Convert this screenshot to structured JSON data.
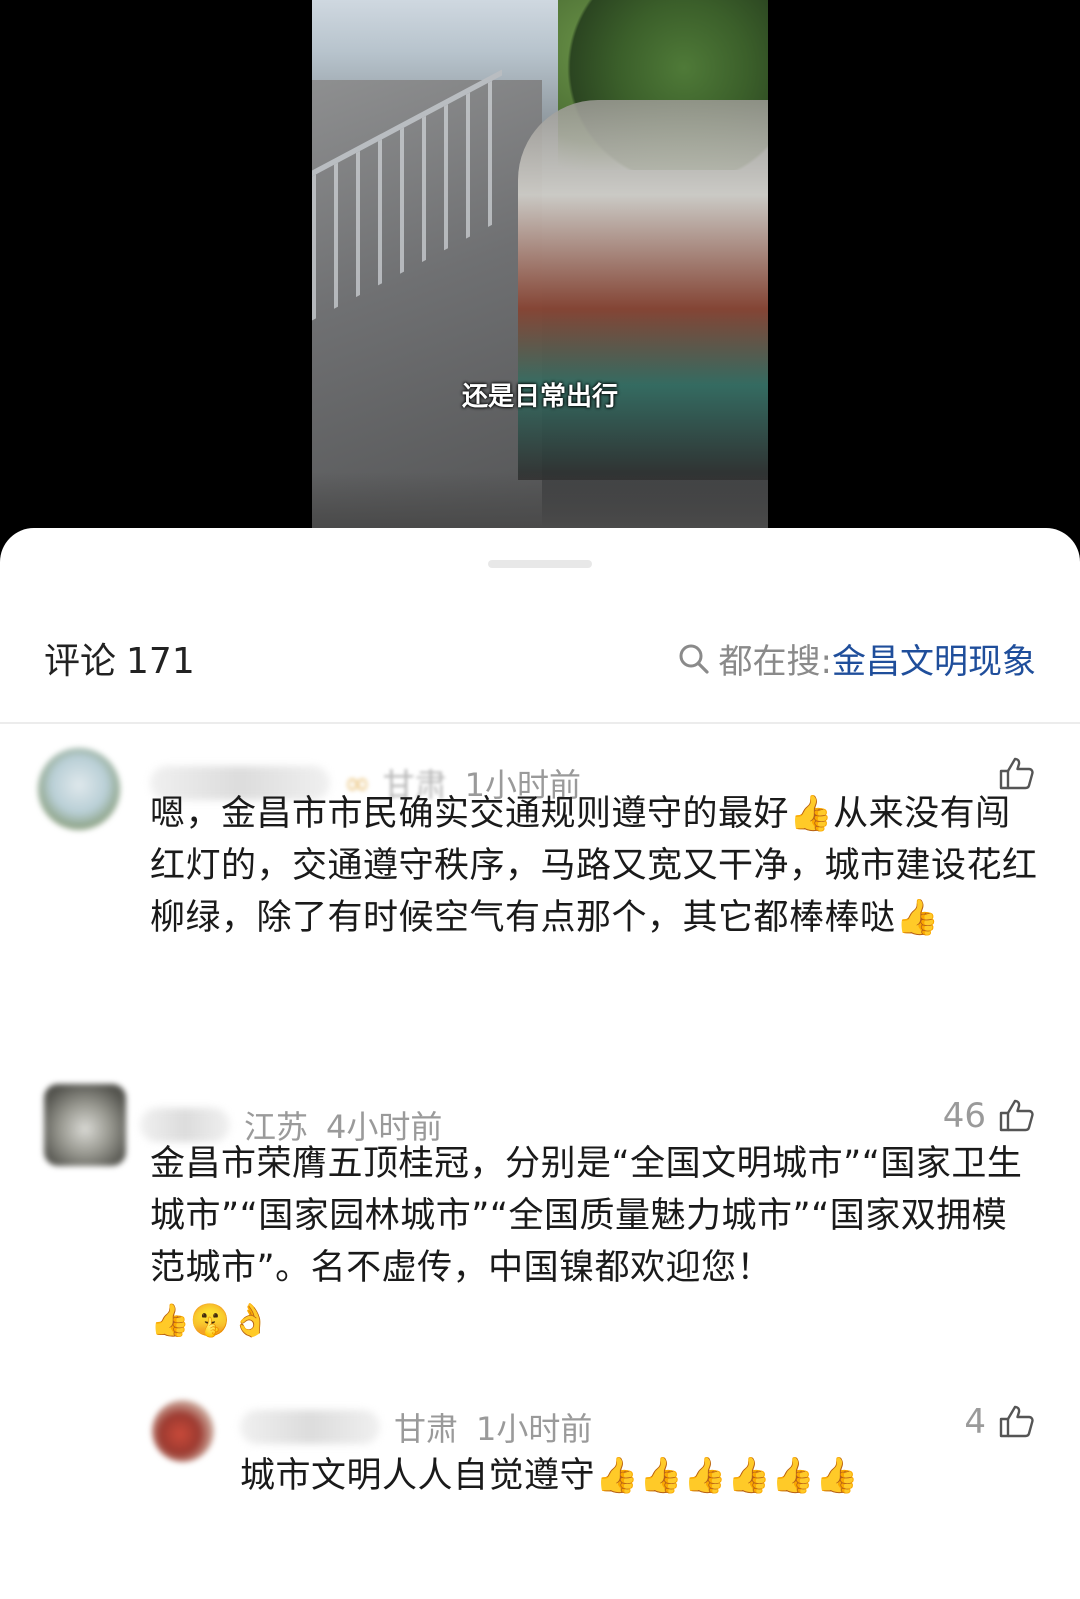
{
  "video": {
    "subtitle": "还是日常出行"
  },
  "header": {
    "comments_label": "评论",
    "comments_count": "171",
    "hot_search_prefix": "都在搜:",
    "hot_search_term": "金昌文明现象"
  },
  "comments": [
    {
      "location": "甘肃",
      "time": "1小时前",
      "likes": "",
      "text": "嗯，金昌市市民确实交通规则遵守的最好👍从来没有闯红灯的，交通遵守秩序，马路又宽又干净，城市建设花红柳绿，除了有时候空气有点那个，其它都棒棒哒👍"
    },
    {
      "location": "江苏",
      "time": "4小时前",
      "likes": "46",
      "text": "金昌市荣膺五顶桂冠，分别是“全国文明城市”“国家卫生城市”“国家园林城市”“全国质量魅力城市”“国家双拥模范城市”。名不虚传，中国镍都欢迎您！",
      "emojis": "👍🤫👌"
    },
    {
      "location": "甘肃",
      "time": "1小时前",
      "likes": "4",
      "text": "城市文明人人自觉遵守👍👍👍👍👍👍"
    }
  ],
  "colors": {
    "accent_link": "#1f4e9b",
    "muted": "#9a9a9a"
  },
  "icons": [
    "search-icon",
    "thumbs-up-icon"
  ]
}
